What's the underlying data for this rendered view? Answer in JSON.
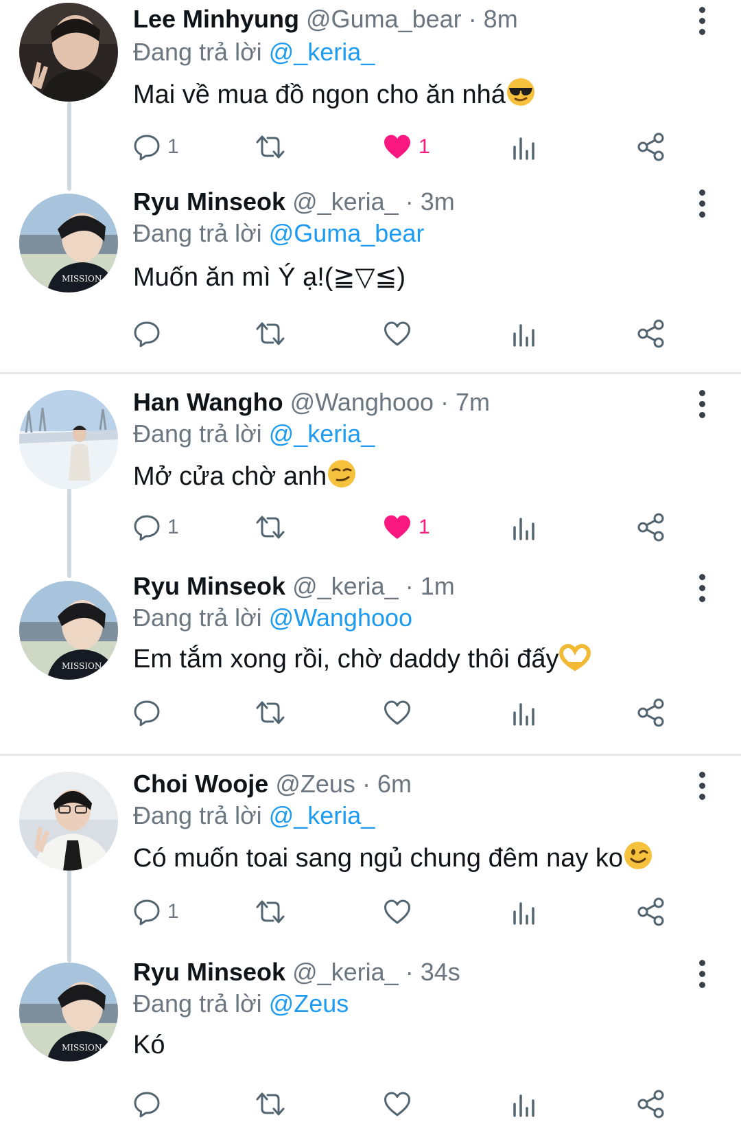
{
  "colors": {
    "mention": "#1d9bf0",
    "like": "#f91880",
    "muted": "#6b7680",
    "thread": "#cfd9de"
  },
  "tweets": [
    {
      "name": "Lee Minhyung",
      "handle": "@Guma_bear",
      "time": "· 8m",
      "reply_prefix": "Đang trả lời",
      "reply_to": "@_keria_",
      "text": "Mai về mua đồ ngon cho ăn nhá",
      "emoji": "sunglasses-emoji",
      "replies": "1",
      "likes": "1",
      "liked": true
    },
    {
      "name": "Ryu Minseok",
      "handle": "@_keria_",
      "time": "· 3m",
      "reply_prefix": "Đang trả lời",
      "reply_to": "@Guma_bear",
      "text": "Muốn ăn mì Ý ạ!(≧▽≦)",
      "emoji": "",
      "replies": "",
      "likes": "",
      "liked": false
    },
    {
      "name": "Han Wangho",
      "handle": "@Wanghooo",
      "time": "· 7m",
      "reply_prefix": "Đang trả lời",
      "reply_to": "@_keria_",
      "text": "Mở cửa chờ anh",
      "emoji": "smirk-emoji",
      "replies": "1",
      "likes": "1",
      "liked": true
    },
    {
      "name": "Ryu Minseok",
      "handle": "@_keria_",
      "time": "· 1m",
      "reply_prefix": "Đang trả lời",
      "reply_to": "@Wanghooo",
      "text": "Em tắm xong rồi, chờ daddy thôi đấy",
      "emoji": "heart-hands-emoji",
      "replies": "",
      "likes": "",
      "liked": false
    },
    {
      "name": "Choi Wooje",
      "handle": "@Zeus",
      "time": "· 6m",
      "reply_prefix": "Đang trả lời",
      "reply_to": "@_keria_",
      "text": "Có muốn toai sang ngủ chung đêm nay ko",
      "emoji": "wink-emoji",
      "replies": "1",
      "likes": "",
      "liked": false
    },
    {
      "name": "Ryu Minseok",
      "handle": "@_keria_",
      "time": "· 34s",
      "reply_prefix": "Đang trả lời",
      "reply_to": "@Zeus",
      "text": "Kó",
      "emoji": "",
      "replies": "",
      "likes": "",
      "liked": false
    }
  ]
}
